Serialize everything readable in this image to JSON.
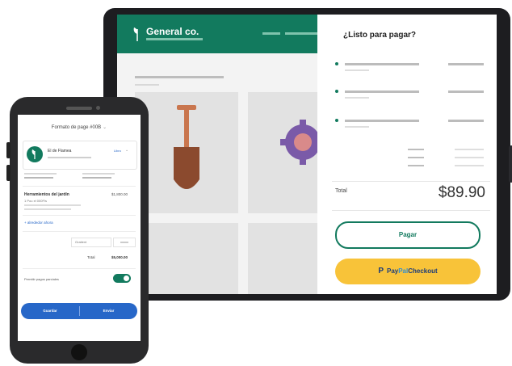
{
  "tablet": {
    "brand_name": "General co.",
    "checkout_title": "¿Listo para pagar?",
    "total_label": "Total",
    "total_amount": "$89.90",
    "pay_button": "Pagar",
    "paypal": {
      "word1": "Pay",
      "word2": "Pal",
      "word3": "Checkout"
    }
  },
  "phone": {
    "title": "Formato de page #00B",
    "merchant": {
      "name": "El de Flamea",
      "link": "Libro"
    },
    "item": {
      "name": "Herramientos del jardín",
      "price": "$1,800.00",
      "qty": "1 Pou el 000FIs"
    },
    "add_link": "+ alrededor ahora",
    "select_label": "Gratient",
    "summary_key": "Total",
    "summary_value": "$5,000.00",
    "toggle_label": "Permitir pagos parciales",
    "toggle_on": true,
    "button_left": "Guardar",
    "button_right": "Enviar"
  },
  "colors": {
    "brand_green": "#127a5e",
    "paypal_yellow": "#f8c339",
    "phone_blue": "#2767c8"
  },
  "icons": [
    "leaf-icon",
    "shovel-icon",
    "gear-icon",
    "paypal-icon",
    "chevron-down-icon"
  ]
}
